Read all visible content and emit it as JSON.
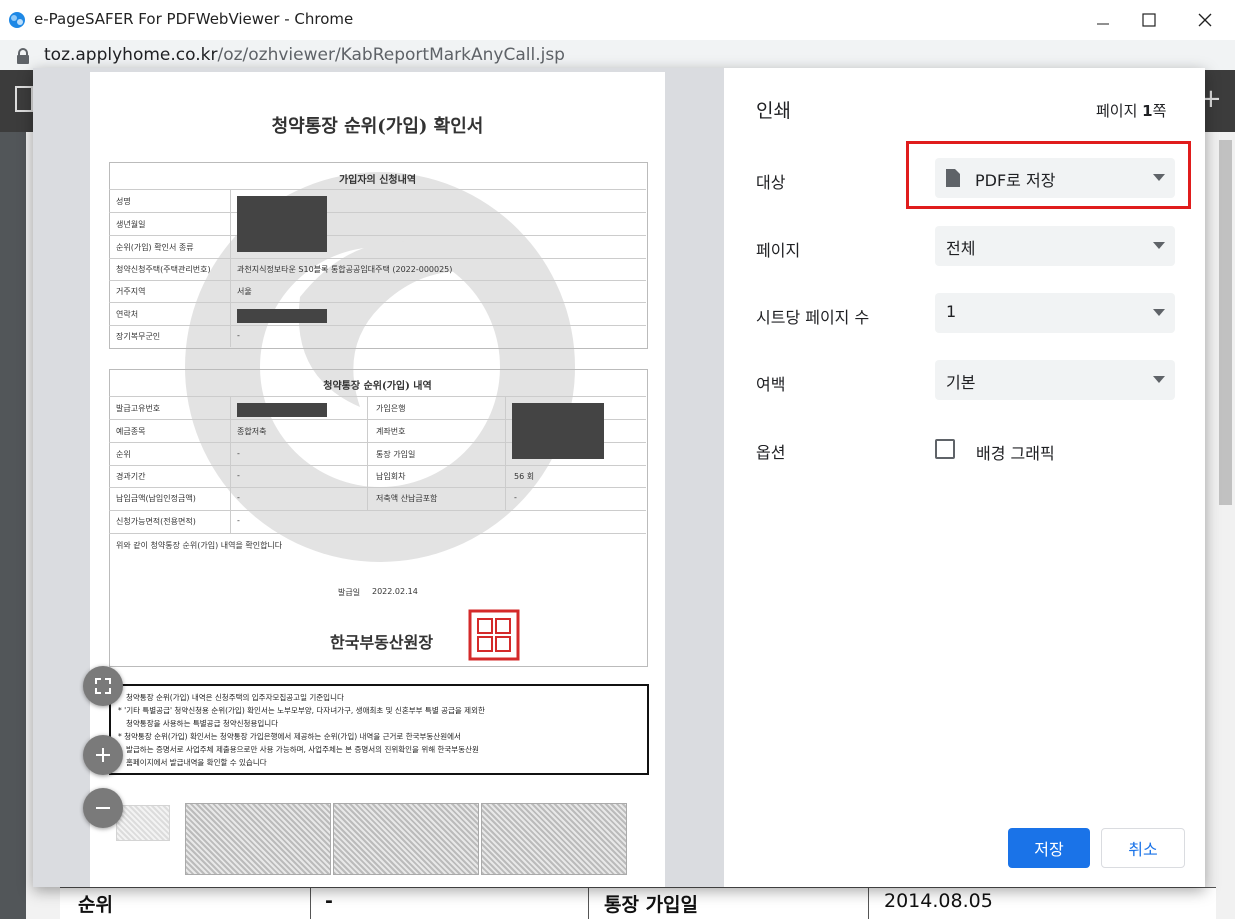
{
  "window": {
    "title": "e-PageSAFER For PDFWebViewer - Chrome",
    "url_host": "toz.applyhome.co.kr",
    "url_path": "/oz/ozhviewer/KabReportMarkAnyCall.jsp"
  },
  "background_row": {
    "cells": [
      "순위",
      "-",
      "통장 가입일",
      "2014.08.05"
    ]
  },
  "document": {
    "title": "청약통장 순위(가입) 확인서",
    "applicant_section": {
      "header": "가입자의 신청내역",
      "labels": [
        "성명",
        "생년월일",
        "순위(가입) 확인서 종류",
        "청약신청주택(주택관리번호)",
        "거주지역",
        "연락처",
        "장기복무군인"
      ],
      "house_value": "과천지식정보타운 S10블록 통합공공임대주택 (2022-000025)",
      "region_value": "서울",
      "military_value": "-"
    },
    "account_section": {
      "header": "청약통장 순위(가입) 내역",
      "left_labels": [
        "발급고유번호",
        "예금종목",
        "순위",
        "경과기간",
        "납입금액(납입인정금액)",
        "신청가능면적(전용면적)"
      ],
      "left_values": [
        "",
        "종합저축",
        "-",
        "-",
        "-",
        "-"
      ],
      "right_labels": [
        "가입은행",
        "계좌번호",
        "통장 가입일",
        "납입회차",
        "저축액 산납금포함"
      ],
      "right_values": [
        "",
        "",
        "",
        "56 회",
        "-"
      ],
      "confirm_text": "위와 같이 청약통장 순위(가입) 내역을 확인합니다",
      "issue_label": "발급일",
      "issue_date": "2022.02.14",
      "issuer": "한국부동산원장"
    },
    "notice_lines": [
      "청약통장 순위(가입) 내역은 신청주택의 입주자모집공고일 기준입니다",
      "* '기타 특별공급' 청약신청용 순위(가입) 확인서는 노부모부양, 다자녀가구, 생애최초 및 신혼부부 특별 공급을 제외한",
      "청약통장을 사용하는 특별공급 청약신청용입니다",
      "* 청약통장 순위(가입) 확인서는 청약통장 가입은행에서 제공하는 순위(가입) 내역을 근거로 한국부동산원에서",
      "발급하는 증명서로 사업주체 제출용으로만 사용 가능하며, 사업주체는 본 증명서의 진위확인을 위해 한국부동산원",
      "홈페이지에서 발급내역을 확인할 수 있습니다"
    ]
  },
  "print": {
    "heading": "인쇄",
    "page_count_prefix": "페이지 ",
    "page_count_number": "1",
    "page_count_suffix": "쪽",
    "destination_label": "대상",
    "destination_value": "PDF로 저장",
    "pages_label": "페이지",
    "pages_value": "전체",
    "per_sheet_label": "시트당 페이지 수",
    "per_sheet_value": "1",
    "margins_label": "여백",
    "margins_value": "기본",
    "options_label": "옵션",
    "background_graphics_label": "배경 그래픽",
    "save_button": "저장",
    "cancel_button": "취소"
  },
  "colors": {
    "primary": "#1a73e8",
    "highlight_border": "#e01c1c",
    "seal": "#d42a2a"
  }
}
